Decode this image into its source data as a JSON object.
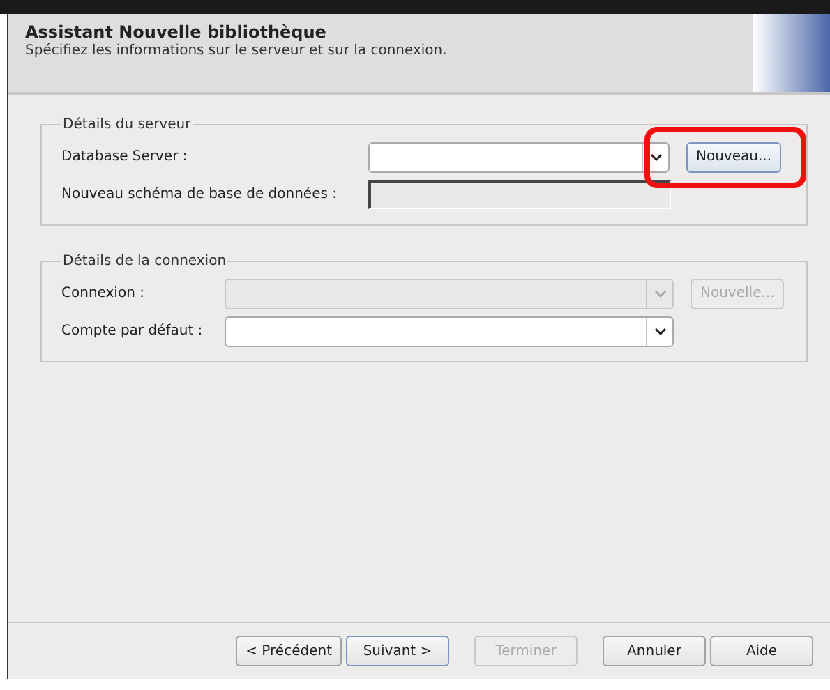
{
  "header": {
    "title": "Assistant Nouvelle bibliothèque",
    "subtitle": "Spécifiez les informations sur le serveur et sur la connexion."
  },
  "groups": [
    {
      "title": "Détails du serveur",
      "rows": [
        {
          "label": "Database Server :",
          "kind": "combo",
          "disabled": false,
          "button": {
            "label": "Nouveau...",
            "disabled": false,
            "highlighted": true
          }
        },
        {
          "label": "Nouveau schéma de base de données :",
          "kind": "text",
          "disabled": true
        }
      ]
    },
    {
      "title": "Détails de la connexion",
      "rows": [
        {
          "label": "Connexion :",
          "kind": "combo",
          "disabled": true,
          "button": {
            "label": "Nouvelle...",
            "disabled": true
          }
        },
        {
          "label": "Compte par défaut :",
          "kind": "combo",
          "disabled": false
        }
      ]
    }
  ],
  "buttons": [
    {
      "label": "< Précédent",
      "disabled": false,
      "focused": false
    },
    {
      "label": "Suivant >",
      "disabled": false,
      "focused": true
    },
    {
      "label": "Terminer",
      "disabled": true,
      "focused": false
    },
    {
      "label": "Annuler",
      "disabled": false,
      "focused": false
    },
    {
      "label": "Aide",
      "disabled": false,
      "focused": false
    }
  ]
}
